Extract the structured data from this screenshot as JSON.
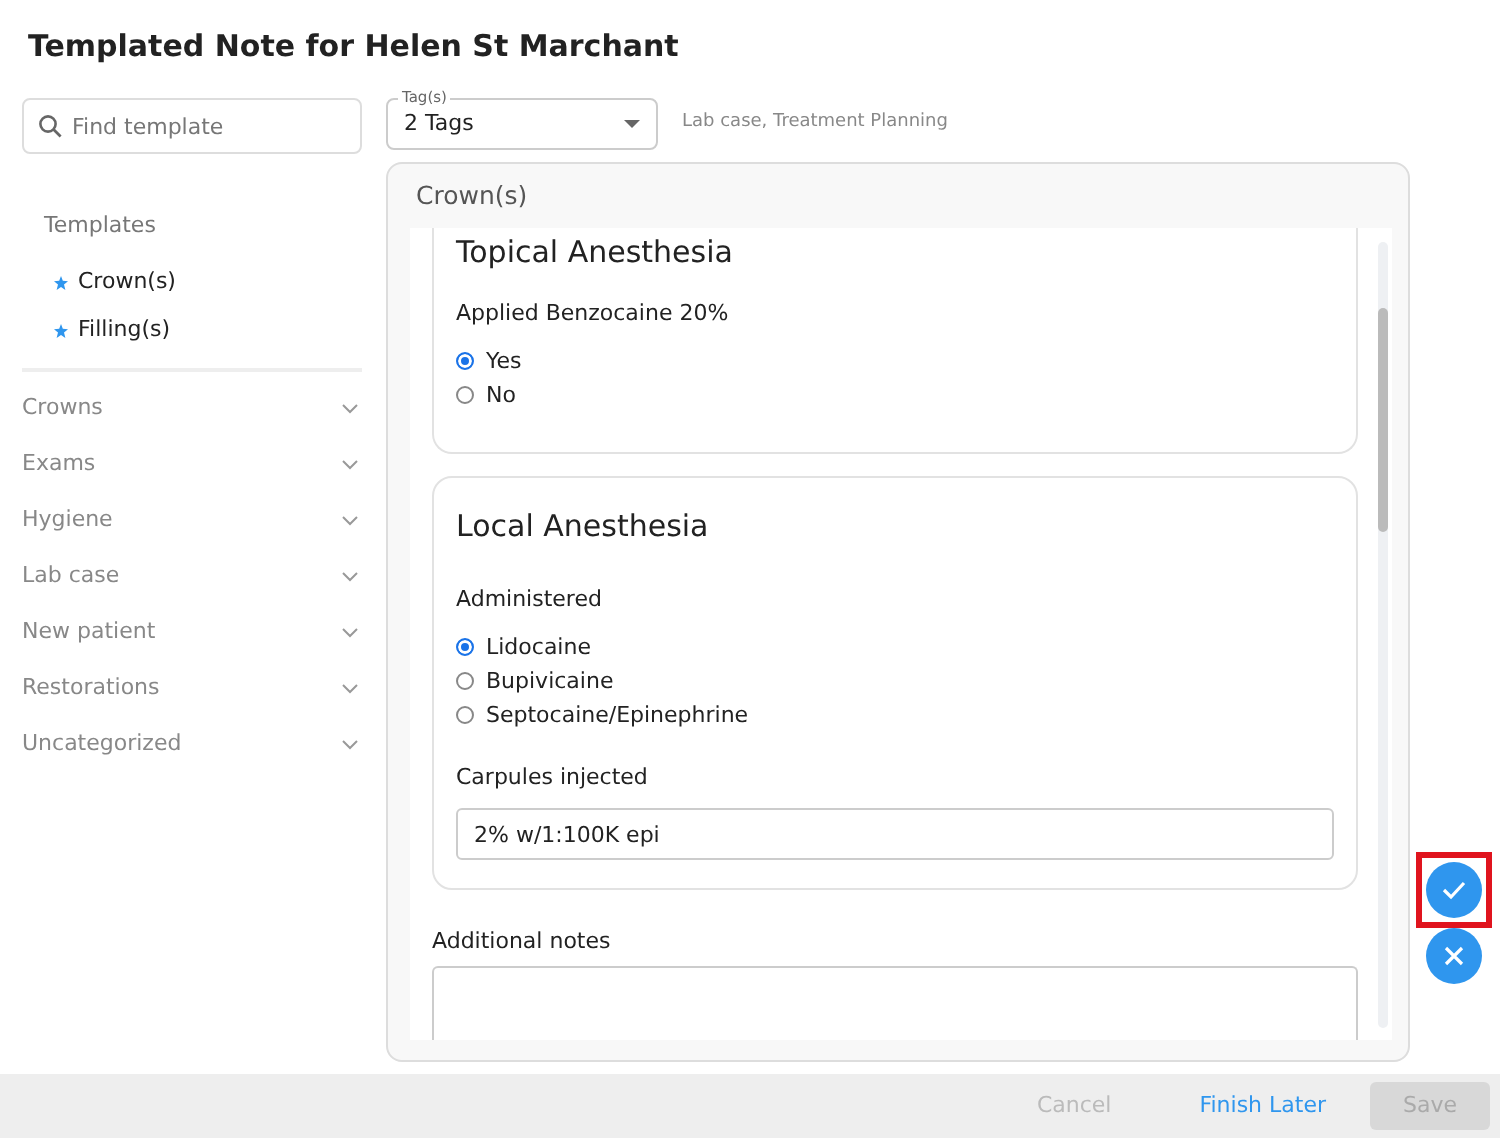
{
  "dialog": {
    "title": "Templated Note for Helen St Marchant"
  },
  "sidebar": {
    "search": {
      "placeholder": "Find template"
    },
    "templates_label": "Templates",
    "templates": [
      {
        "label": "Crown(s)"
      },
      {
        "label": "Filling(s)"
      }
    ],
    "categories": [
      {
        "label": "Crowns"
      },
      {
        "label": "Exams"
      },
      {
        "label": "Hygiene"
      },
      {
        "label": "Lab case"
      },
      {
        "label": "New patient"
      },
      {
        "label": "Restorations"
      },
      {
        "label": "Uncategorized"
      }
    ]
  },
  "tags": {
    "label": "Tag(s)",
    "value": "2 Tags",
    "summary": "Lab case, Treatment Planning"
  },
  "panel": {
    "title": "Crown(s)",
    "sections": [
      {
        "title": "Topical Anesthesia",
        "fields": [
          {
            "kind": "radio",
            "label": "Applied Benzocaine 20%",
            "options": [
              {
                "label": "Yes",
                "selected": true
              },
              {
                "label": "No",
                "selected": false
              }
            ]
          }
        ]
      },
      {
        "title": "Local Anesthesia",
        "fields": [
          {
            "kind": "radio",
            "label": "Administered",
            "options": [
              {
                "label": "Lidocaine",
                "selected": true
              },
              {
                "label": "Bupivicaine",
                "selected": false
              },
              {
                "label": "Septocaine/Epinephrine",
                "selected": false
              }
            ]
          },
          {
            "kind": "text",
            "label": "Carpules injected",
            "value": "2% w/1:100K epi"
          }
        ]
      }
    ],
    "notes": {
      "label": "Additional notes"
    }
  },
  "fabs": [
    {
      "kind": "confirm",
      "highlighted": true
    },
    {
      "kind": "close",
      "highlighted": false
    }
  ],
  "footer": {
    "buttons": [
      {
        "label": "Cancel",
        "kind": "text",
        "disabled": true
      },
      {
        "label": "Finish Later",
        "kind": "text",
        "disabled": false
      },
      {
        "label": "Save",
        "kind": "filled",
        "disabled": true
      }
    ]
  }
}
